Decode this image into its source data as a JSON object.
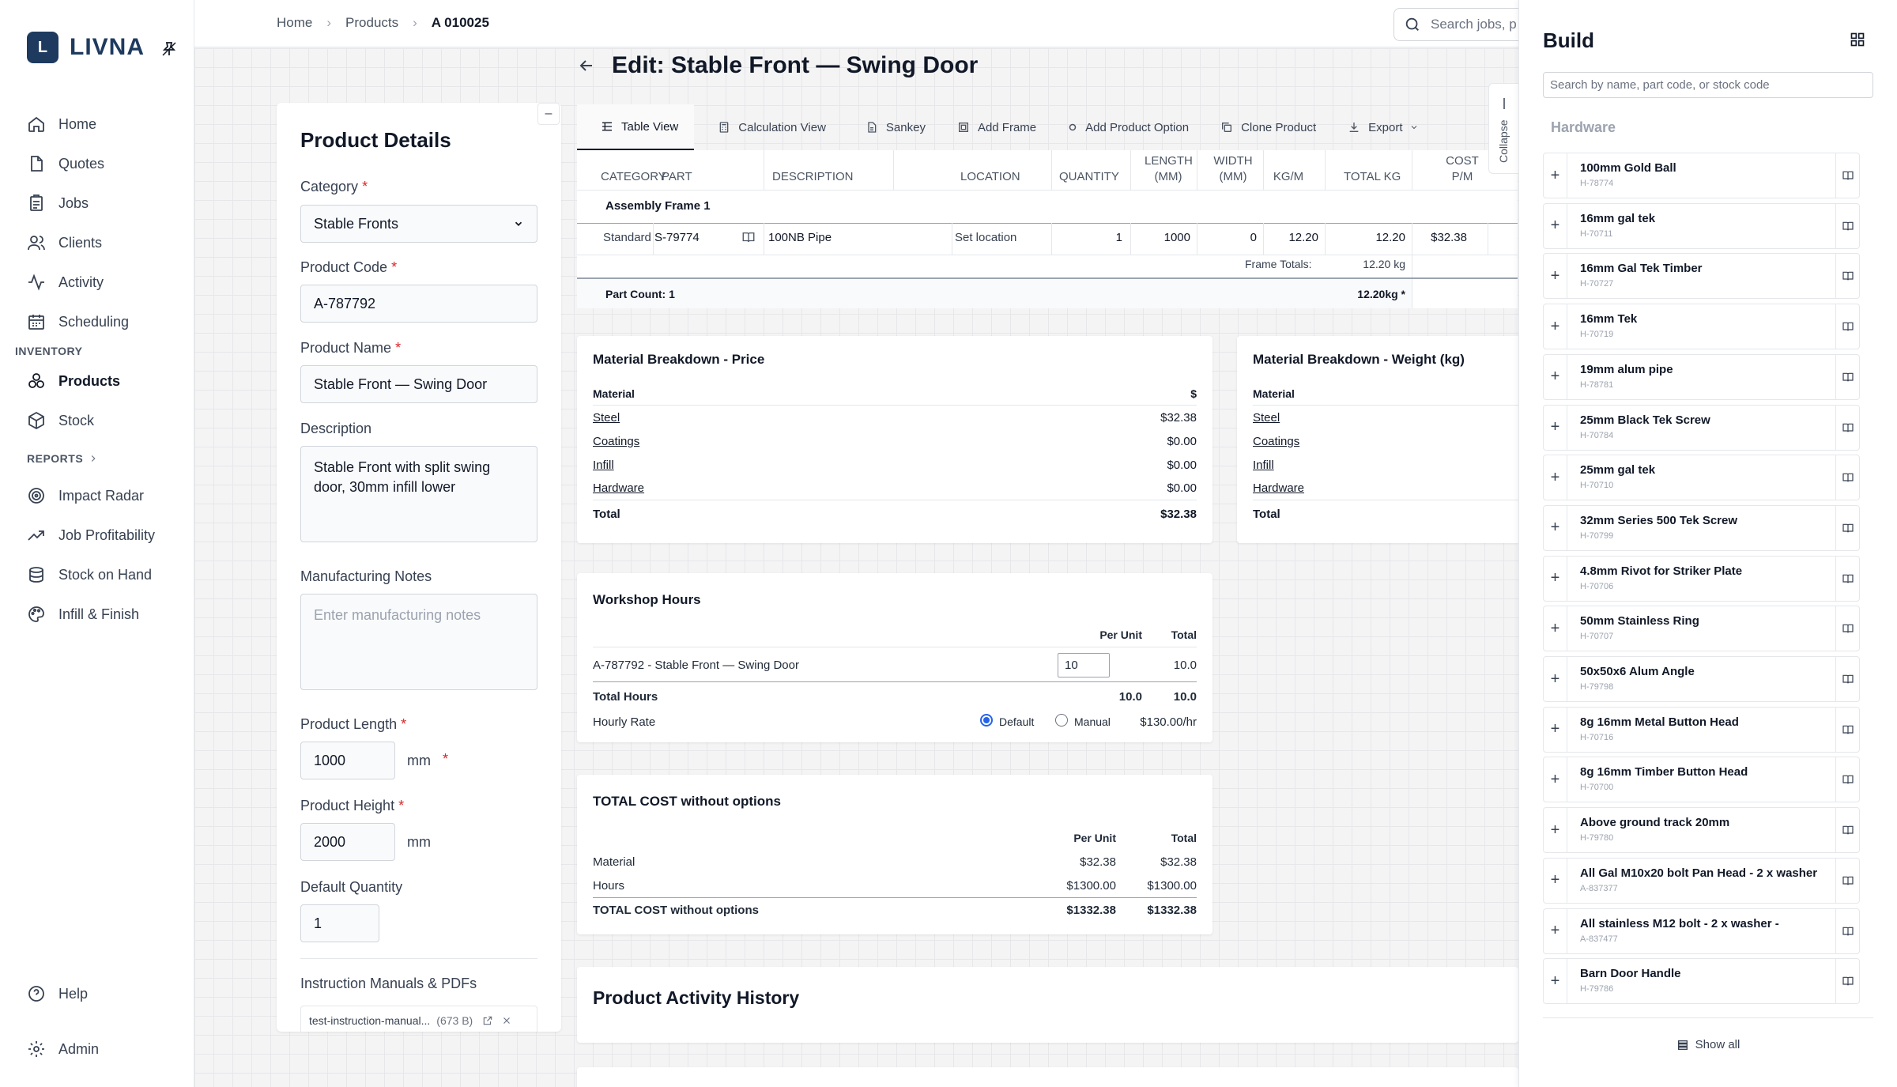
{
  "app": {
    "logo_letter": "L",
    "name": "LIVNA"
  },
  "nav": {
    "main": [
      {
        "label": "Home",
        "icon": "home-icon"
      },
      {
        "label": "Quotes",
        "icon": "document-icon"
      },
      {
        "label": "Jobs",
        "icon": "clipboard-icon"
      },
      {
        "label": "Clients",
        "icon": "users-icon"
      },
      {
        "label": "Activity",
        "icon": "activity-icon"
      },
      {
        "label": "Scheduling",
        "icon": "calendar-icon"
      }
    ],
    "inventory_label": "INVENTORY",
    "inventory": [
      {
        "label": "Products",
        "icon": "products-icon",
        "active": true
      },
      {
        "label": "Stock",
        "icon": "box-icon"
      }
    ],
    "reports_label": "REPORTS",
    "reports": [
      {
        "label": "Impact Radar",
        "icon": "radar-icon"
      },
      {
        "label": "Job Profitability",
        "icon": "trend-icon"
      },
      {
        "label": "Stock on Hand",
        "icon": "stack-icon"
      },
      {
        "label": "Infill & Finish",
        "icon": "palette-icon"
      }
    ],
    "help": "Help",
    "admin": "Admin"
  },
  "breadcrumb": {
    "home": "Home",
    "products": "Products",
    "current": "A 010025"
  },
  "search": {
    "placeholder": "Search jobs, p"
  },
  "page": {
    "title": "Edit: Stable Front — Swing Door"
  },
  "details": {
    "title": "Product Details",
    "category_label": "Category",
    "category_value": "Stable Fronts",
    "code_label": "Product Code",
    "code_value": "A-787792",
    "name_label": "Product Name",
    "name_value": "Stable Front — Swing Door",
    "description_label": "Description",
    "description_value": "Stable Front with split swing door, 30mm infill lower",
    "notes_label": "Manufacturing Notes",
    "notes_placeholder": "Enter manufacturing notes",
    "length_label": "Product Length",
    "length_value": "1000",
    "height_label": "Product Height",
    "height_value": "2000",
    "unit": "mm",
    "qty_label": "Default Quantity",
    "qty_value": "1",
    "manuals_label": "Instruction Manuals & PDFs",
    "file_name": "test-instruction-manual...",
    "file_size": "(673 B)"
  },
  "tabs": [
    {
      "label": "Table View",
      "icon": "table-icon",
      "active": true
    },
    {
      "label": "Calculation View",
      "icon": "calculator-icon"
    },
    {
      "label": "Sankey",
      "icon": "sankey-icon"
    },
    {
      "label": "Add Frame",
      "icon": "frame-icon"
    },
    {
      "label": "Add Product Option",
      "icon": "option-icon"
    },
    {
      "label": "Clone Product",
      "icon": "clone-icon"
    },
    {
      "label": "Export",
      "icon": "download-icon"
    }
  ],
  "parts_table": {
    "headers": {
      "category": "CATEGORY",
      "part": "PART",
      "description": "DESCRIPTION",
      "location": "LOCATION",
      "quantity": "QUANTITY",
      "length_1": "LENGTH",
      "length_2": "(MM)",
      "width_1": "WIDTH",
      "width_2": "(MM)",
      "kgm": "KG/M",
      "total_kg": "TOTAL KG",
      "cost_1": "COST",
      "cost_2": "P/M"
    },
    "group": "Assembly Frame 1",
    "row": {
      "category": "Standard",
      "part": "S-79774",
      "description": "100NB Pipe",
      "location": "Set location",
      "quantity": "1",
      "length": "1000",
      "width": "0",
      "kgm": "12.20",
      "total_kg": "12.20",
      "cost": "$32.38"
    },
    "frame_totals_label": "Frame Totals:",
    "frame_totals_value": "12.20 kg",
    "part_count": "Part Count: 1",
    "total_weight": "12.20kg *"
  },
  "price_breakdown": {
    "title": "Material Breakdown - Price",
    "col_material": "Material",
    "col_value": "$",
    "rows": [
      {
        "label": "Steel",
        "value": "$32.38"
      },
      {
        "label": "Coatings",
        "value": "$0.00"
      },
      {
        "label": "Infill",
        "value": "$0.00"
      },
      {
        "label": "Hardware",
        "value": "$0.00"
      }
    ],
    "total_label": "Total",
    "total_value": "$32.38"
  },
  "weight_breakdown": {
    "title": "Material Breakdown - Weight (kg)",
    "col_material": "Material",
    "rows": [
      "Steel",
      "Coatings",
      "Infill",
      "Hardware"
    ],
    "total_label": "Total"
  },
  "workshop": {
    "title": "Workshop Hours",
    "col_per_unit": "Per Unit",
    "col_total": "Total",
    "item_label": "A-787792 - Stable Front — Swing Door",
    "item_per_unit": "10",
    "item_total": "10.0",
    "total_hours_label": "Total Hours",
    "total_hours_per_unit": "10.0",
    "total_hours_total": "10.0",
    "rate_label": "Hourly Rate",
    "rate_default": "Default",
    "rate_manual": "Manual",
    "rate_value": "$130.00/hr"
  },
  "total_cost": {
    "title": "TOTAL COST without options",
    "col_per_unit": "Per Unit",
    "col_total": "Total",
    "rows": [
      {
        "label": "Material",
        "per_unit": "$32.38",
        "total": "$32.38"
      },
      {
        "label": "Hours",
        "per_unit": "$1300.00",
        "total": "$1300.00"
      }
    ],
    "total_label": "TOTAL COST without options",
    "total_per_unit": "$1332.38",
    "total_total": "$1332.38"
  },
  "activity": {
    "title": "Product Activity History"
  },
  "collapse_label": "Collapse",
  "build": {
    "title": "Build",
    "search_placeholder": "Search by name, part code, or stock code",
    "section": "Hardware",
    "items": [
      {
        "name": "100mm Gold Ball",
        "code": "H-78774"
      },
      {
        "name": "16mm gal tek",
        "code": "H-70711"
      },
      {
        "name": "16mm Gal Tek Timber",
        "code": "H-70727"
      },
      {
        "name": "16mm Tek",
        "code": "H-70719"
      },
      {
        "name": "19mm alum pipe",
        "code": "H-78781"
      },
      {
        "name": "25mm Black Tek Screw",
        "code": "H-70784"
      },
      {
        "name": "25mm gal tek",
        "code": "H-70710"
      },
      {
        "name": "32mm Series 500 Tek Screw",
        "code": "H-70799"
      },
      {
        "name": "4.8mm Rivot for Striker Plate",
        "code": "H-70706"
      },
      {
        "name": "50mm Stainless Ring",
        "code": "H-70707"
      },
      {
        "name": "50x50x6 Alum Angle",
        "code": "H-79798"
      },
      {
        "name": "8g 16mm Metal Button Head",
        "code": "H-70716"
      },
      {
        "name": "8g 16mm Timber Button Head",
        "code": "H-70700"
      },
      {
        "name": "Above ground track 20mm",
        "code": "H-79780"
      },
      {
        "name": "All Gal M10x20 bolt Pan Head - 2 x washer",
        "code": "A-837377"
      },
      {
        "name": "All stainless M12 bolt - 2 x washer -",
        "code": "A-837477"
      },
      {
        "name": "Barn Door Handle",
        "code": "H-79786"
      }
    ],
    "show_all": "Show all"
  }
}
